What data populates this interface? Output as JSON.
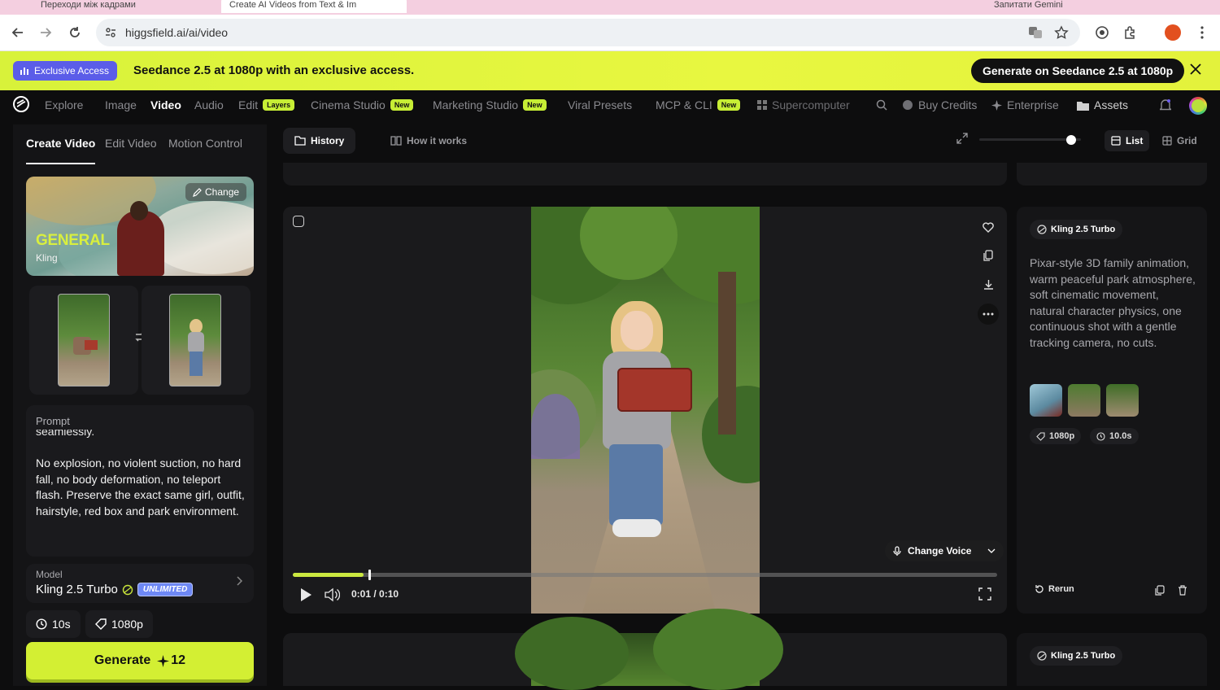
{
  "browser": {
    "tabs": [
      {
        "title": "Переходи між кадрами"
      },
      {
        "title": "Create AI Videos from Text & Im"
      },
      {
        "title": "Запитати Gemini"
      }
    ],
    "url": "higgsfield.ai/ai/video"
  },
  "banner": {
    "badge": "Exclusive Access",
    "text": "Seedance 2.5 at 1080p with an exclusive access.",
    "cta": "Generate on Seedance 2.5 at 1080p"
  },
  "nav": {
    "items": [
      {
        "label": "Explore"
      },
      {
        "label": "Image"
      },
      {
        "label": "Video"
      },
      {
        "label": "Audio"
      },
      {
        "label": "Edit",
        "badge": "Layers"
      },
      {
        "label": "Cinema Studio",
        "badge": "New"
      },
      {
        "label": "Marketing Studio",
        "badge": "New"
      },
      {
        "label": "Viral Presets"
      },
      {
        "label": "MCP & CLI",
        "badge": "New"
      },
      {
        "label": "Supercomputer"
      }
    ],
    "buy_credits": "Buy Credits",
    "enterprise": "Enterprise",
    "assets": "Assets"
  },
  "left_panel": {
    "tabs": [
      "Create Video",
      "Edit Video",
      "Motion Control"
    ],
    "preset": {
      "title": "GENERAL",
      "subtitle": "Kling",
      "change": "Change"
    },
    "prompt": {
      "label": "Prompt",
      "previous_line": "seamlessly.",
      "text": "No explosion, no violent suction, no hard fall, no body deformation, no teleport flash. Preserve the exact same girl, outfit, hairstyle, red box and park environment."
    },
    "model": {
      "label": "Model",
      "value": "Kling 2.5 Turbo",
      "badge": "UNLIMITED"
    },
    "duration": "10s",
    "resolution": "1080p",
    "generate": {
      "label": "Generate",
      "cost": "12"
    }
  },
  "toolbar": {
    "history": "History",
    "how_it_works": "How it works",
    "list": "List",
    "grid": "Grid",
    "zoom_level": 0.9
  },
  "video_card": {
    "change_voice": "Change Voice",
    "time": "0:01 / 0:10",
    "progress": 0.1
  },
  "info_panel": {
    "model": "Kling 2.5 Turbo",
    "description": "Pixar-style 3D family animation, warm peaceful park atmosphere, soft cinematic movement, natural character physics, one continuous shot with a gentle tracking camera, no cuts.",
    "resolution": "1080p",
    "duration": "10.0s",
    "rerun": "Rerun"
  },
  "next_card": {
    "model": "Kling 2.5 Turbo"
  }
}
